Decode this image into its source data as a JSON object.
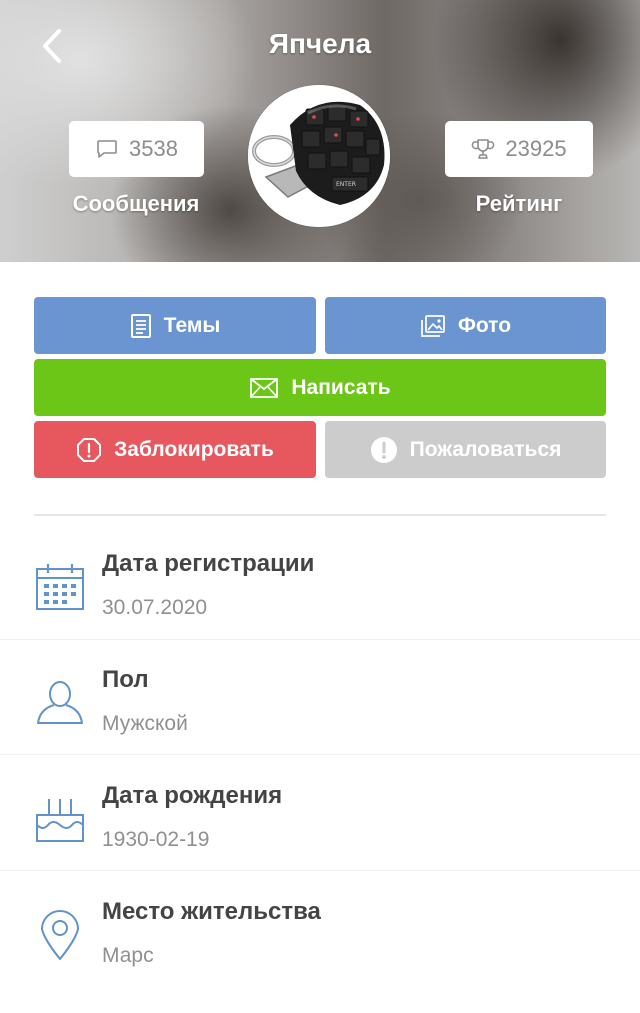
{
  "header": {
    "title": "Япчела",
    "messages": {
      "count": "3538",
      "label": "Сообщения",
      "icon": "chat-bubble-icon"
    },
    "rating": {
      "count": "23925",
      "label": "Рейтинг",
      "icon": "trophy-icon"
    },
    "avatar": {
      "icon": "keyboard-grenade-avatar"
    },
    "back_icon": "back-chevron-icon"
  },
  "actions": {
    "topics": {
      "label": "Темы",
      "icon": "document-icon"
    },
    "photo": {
      "label": "Фото",
      "icon": "image-icon"
    },
    "write": {
      "label": "Написать",
      "icon": "envelope-icon"
    },
    "block": {
      "label": "Заблокировать",
      "icon": "octagon-alert-icon"
    },
    "report": {
      "label": "Пожаловаться",
      "icon": "exclamation-circle-icon"
    }
  },
  "info": [
    {
      "label": "Дата регистрации",
      "value": "30.07.2020",
      "icon": "calendar-icon"
    },
    {
      "label": "Пол",
      "value": "Мужской",
      "icon": "user-icon"
    },
    {
      "label": "Дата рождения",
      "value": "1930-02-19",
      "icon": "birthday-cake-icon"
    },
    {
      "label": "Место жительства",
      "value": "Марс",
      "icon": "location-pin-icon"
    }
  ],
  "colors": {
    "primary_blue": "#6a95d1",
    "write_green": "#6cc618",
    "block_red": "#e6585e",
    "report_gray": "#cccccc",
    "info_icon_blue": "#5f93c9"
  }
}
